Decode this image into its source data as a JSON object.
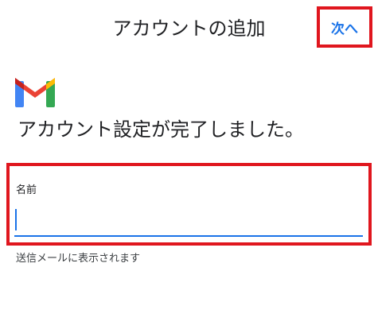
{
  "header": {
    "title": "アカウントの追加",
    "next_label": "次へ"
  },
  "logo": {
    "icon": "gmail-icon"
  },
  "heading": "アカウント設定が完了しました。",
  "name_field": {
    "label": "名前",
    "value": "",
    "helper_text": "送信メールに表示されます"
  },
  "colors": {
    "accent": "#1a73e8",
    "highlight": "#e0161e",
    "text": "#202124"
  }
}
